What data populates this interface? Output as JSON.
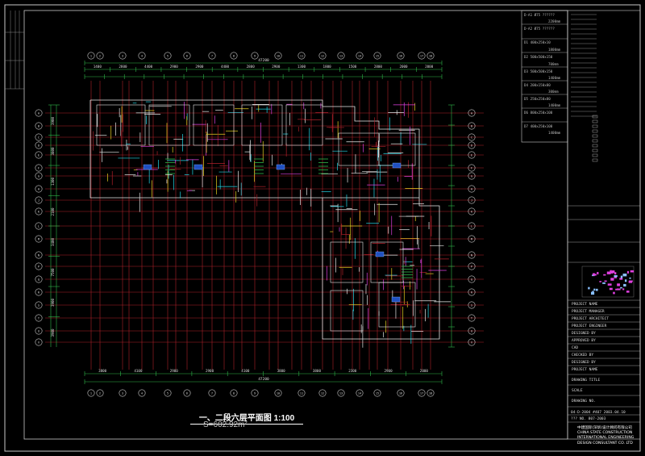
{
  "drawing": {
    "title": "一、二段六层平面图 1:100",
    "area": "S=602.92m²",
    "top_total_dim": "47200",
    "bottom_total_dim": "47200",
    "top_dims": [
      "1400",
      "2800",
      "4400",
      "2900",
      "2900",
      "4400",
      "2800",
      "2900",
      "1300",
      "1800",
      "1500",
      "2800",
      "2000",
      "2000"
    ],
    "bottom_dims": [
      "3800",
      "4100",
      "2900",
      "2900",
      "4100",
      "3800",
      "3800",
      "2300",
      "2900",
      "2000"
    ],
    "left_dims": [
      "3900",
      "3800",
      "1300",
      "2100",
      "3400",
      "7500",
      "3900",
      "3900"
    ]
  },
  "notes": {
    "windows": [
      {
        "code": "D-A1",
        "text": "Ø75 ??????"
      },
      {
        "code": "D-A2",
        "text": "Ø75 ??????"
      },
      {
        "code": "D1",
        "text": "400x250x10"
      },
      {
        "code": "D2",
        "text": "500x500x150"
      },
      {
        "code": "D3",
        "text": "500x500x150"
      },
      {
        "code": "D4",
        "text": "200x150x80"
      },
      {
        "code": "D5",
        "text": "250x250x80"
      },
      {
        "code": "D6",
        "text": "800x250x100"
      },
      {
        "code": "D7",
        "text": "400x250x100"
      }
    ],
    "dims": [
      "2200mm",
      "1800mm",
      "700mm",
      "1400mm",
      "300mm",
      "1400mm",
      "1400mm"
    ]
  },
  "title_block": {
    "date_row": [
      "04-D-2004",
      "#407",
      "2003.04.10"
    ],
    "sheet_no": "??? NO. 807-2003",
    "company_lines": [
      "中建国际(深圳)设计顾问有限公司",
      "CHINA STATE CONSTRUCTION",
      "INTERNATIONAL ENGINEERING",
      "DESIGN CONSULTANT CO. LTD"
    ],
    "rows": [
      "PROJECT NAME",
      "PROJECT MANAGER",
      "PROJECT ARCHITECT",
      "PROJECT ENGINEER",
      "DESIGNED BY",
      "APPROVED BY",
      "CAD",
      "CHECKED BY",
      "DESIGNED BY",
      "PROJECT NAME",
      "DRAWING TITLE",
      "SCALE",
      "DRAWING NO."
    ]
  },
  "colors": {
    "background": "#000000",
    "grid_red": "#b0202a",
    "dim_green": "#2fb84a",
    "walls_white": "#e8e8e8",
    "elements_magenta": "#e040e0",
    "elements_cyan": "#22d8e8",
    "elements_yellow": "#e8d020",
    "border": "#c8c8c8"
  }
}
